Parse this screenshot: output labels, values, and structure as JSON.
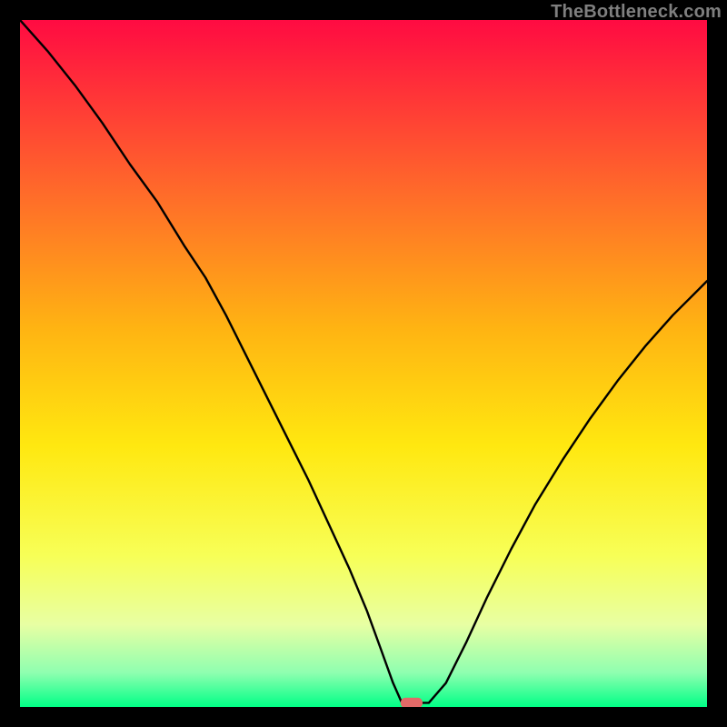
{
  "watermark": "TheBottleneck.com",
  "chart_data": {
    "type": "line",
    "title": "",
    "xlabel": "",
    "ylabel": "",
    "xlim": [
      0,
      100
    ],
    "ylim": [
      0,
      100
    ],
    "gradient_stops": [
      {
        "offset": 0,
        "color": "#ff0b42"
      },
      {
        "offset": 25,
        "color": "#ff6a2a"
      },
      {
        "offset": 45,
        "color": "#ffb412"
      },
      {
        "offset": 62,
        "color": "#ffe810"
      },
      {
        "offset": 78,
        "color": "#f7ff57"
      },
      {
        "offset": 88,
        "color": "#e8ffa3"
      },
      {
        "offset": 95,
        "color": "#8fffb0"
      },
      {
        "offset": 100,
        "color": "#00ff86"
      }
    ],
    "series": [
      {
        "name": "curve",
        "x": [
          0.0,
          4.0,
          8.0,
          12.0,
          16.0,
          20.0,
          24.0,
          27.0,
          30.0,
          33.0,
          36.0,
          39.0,
          42.0,
          45.0,
          48.0,
          50.5,
          52.5,
          54.3,
          55.5,
          57.0,
          59.5,
          62.0,
          65.0,
          68.0,
          71.5,
          75.0,
          79.0,
          83.0,
          87.0,
          91.0,
          95.0,
          100.0
        ],
        "y": [
          100.0,
          95.5,
          90.5,
          85.0,
          79.0,
          73.5,
          67.0,
          62.5,
          57.0,
          51.0,
          45.0,
          39.0,
          33.0,
          26.5,
          20.0,
          14.0,
          8.5,
          3.5,
          0.8,
          0.6,
          0.6,
          3.5,
          9.5,
          16.0,
          23.0,
          29.5,
          36.0,
          42.0,
          47.5,
          52.5,
          57.0,
          62.0
        ]
      }
    ],
    "marker": {
      "x": 57.0,
      "y": 0.6,
      "color": "#e26a68"
    }
  }
}
